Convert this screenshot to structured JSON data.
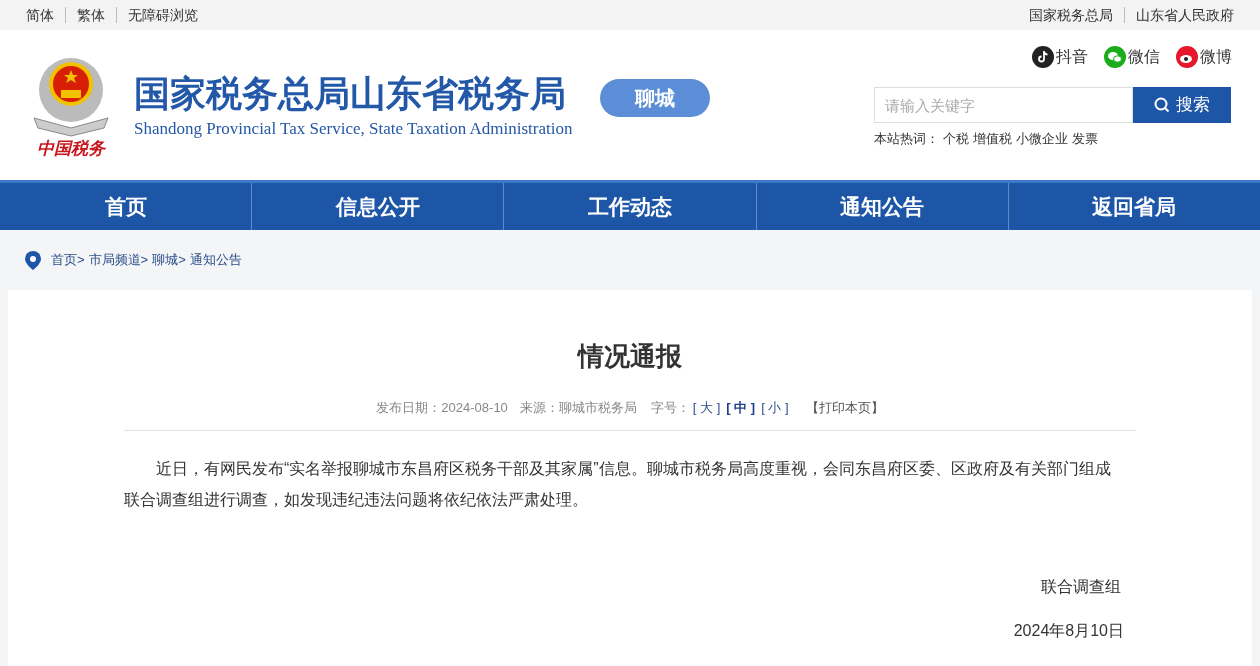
{
  "top_bar": {
    "left_links": [
      "简体",
      "繁体",
      "无障碍浏览"
    ],
    "right_links": [
      "国家税务总局",
      "山东省人民政府"
    ]
  },
  "header": {
    "logo_caption": "中国税务",
    "title": "国家税务总局山东省税务局",
    "subtitle": "Shandong Provincial Tax Service, State Taxation Administration",
    "city_badge": "聊城",
    "social": [
      {
        "kind": "douyin",
        "label": "抖音"
      },
      {
        "kind": "wechat",
        "label": "微信"
      },
      {
        "kind": "weibo",
        "label": "微博"
      }
    ],
    "search": {
      "placeholder": "请输入关键字",
      "button": "搜索"
    },
    "hot_words": {
      "label": "本站热词：",
      "words": [
        "个税",
        "增值税",
        "小微企业",
        "发票"
      ]
    }
  },
  "nav": [
    "首页",
    "信息公开",
    "工作动态",
    "通知公告",
    "返回省局"
  ],
  "breadcrumb": [
    "首页>",
    "市局频道>",
    "聊城>",
    "通知公告"
  ],
  "article": {
    "title": "情况通报",
    "date_label": "发布日期：",
    "date": "2024-08-10",
    "source_label": "来源：",
    "source": "聊城市税务局",
    "font_label": "字号：",
    "font_sizes": [
      {
        "label": "[ 大 ]",
        "selected": false
      },
      {
        "label": "[ 中 ]",
        "selected": true
      },
      {
        "label": "[ 小 ]",
        "selected": false
      }
    ],
    "print": "【打印本页】",
    "body": "近日，有网民发布“实名举报聊城市东昌府区税务干部及其家属”信息。聊城市税务局高度重视，会同东昌府区委、区政府及有关部门组成联合调查组进行调查，如发现违纪违法问题将依纪依法严肃处理。",
    "signature": "联合调查组",
    "sign_date": "2024年8月10日"
  }
}
